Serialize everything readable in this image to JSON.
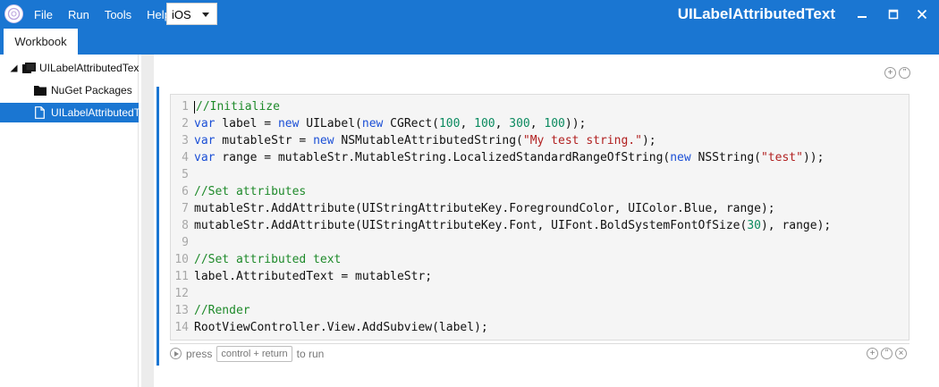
{
  "titlebar": {
    "menu": [
      "File",
      "Run",
      "Tools",
      "Help"
    ],
    "platform_selected": "iOS",
    "window_title": "UILabelAttributedText"
  },
  "tabs": [
    {
      "label": "Workbook"
    }
  ],
  "sidebar": {
    "items": [
      {
        "label": "UILabelAttributedText",
        "type": "workbook",
        "expanded": true
      },
      {
        "label": "NuGet Packages",
        "type": "folder"
      },
      {
        "label": "UILabelAttributedText",
        "type": "file",
        "selected": true
      }
    ]
  },
  "editor": {
    "lines": [
      {
        "n": "1",
        "tokens": [
          {
            "t": "//Initialize",
            "c": "cm"
          }
        ]
      },
      {
        "n": "2",
        "tokens": [
          {
            "t": "var",
            "c": "kw"
          },
          {
            "t": " label = ",
            "c": "code"
          },
          {
            "t": "new",
            "c": "kw"
          },
          {
            "t": " UILabel(",
            "c": "code"
          },
          {
            "t": "new",
            "c": "kw"
          },
          {
            "t": " CGRect(",
            "c": "code"
          },
          {
            "t": "100",
            "c": "num"
          },
          {
            "t": ", ",
            "c": "code"
          },
          {
            "t": "100",
            "c": "num"
          },
          {
            "t": ", ",
            "c": "code"
          },
          {
            "t": "300",
            "c": "num"
          },
          {
            "t": ", ",
            "c": "code"
          },
          {
            "t": "100",
            "c": "num"
          },
          {
            "t": "));",
            "c": "code"
          }
        ]
      },
      {
        "n": "3",
        "tokens": [
          {
            "t": "var",
            "c": "kw"
          },
          {
            "t": " mutableStr = ",
            "c": "code"
          },
          {
            "t": "new",
            "c": "kw"
          },
          {
            "t": " NSMutableAttributedString(",
            "c": "code"
          },
          {
            "t": "\"My test string.\"",
            "c": "str"
          },
          {
            "t": ");",
            "c": "code"
          }
        ]
      },
      {
        "n": "4",
        "tokens": [
          {
            "t": "var",
            "c": "kw"
          },
          {
            "t": " range = mutableStr.MutableString.LocalizedStandardRangeOfString(",
            "c": "code"
          },
          {
            "t": "new",
            "c": "kw"
          },
          {
            "t": " NSString(",
            "c": "code"
          },
          {
            "t": "\"test\"",
            "c": "str"
          },
          {
            "t": "));",
            "c": "code"
          }
        ]
      },
      {
        "n": "5",
        "tokens": []
      },
      {
        "n": "6",
        "tokens": [
          {
            "t": "//Set attributes",
            "c": "cm"
          }
        ]
      },
      {
        "n": "7",
        "tokens": [
          {
            "t": "mutableStr.AddAttribute(UIStringAttributeKey.ForegroundColor, UIColor.Blue, range);",
            "c": "code"
          }
        ]
      },
      {
        "n": "8",
        "tokens": [
          {
            "t": "mutableStr.AddAttribute(UIStringAttributeKey.Font, UIFont.BoldSystemFontOfSize(",
            "c": "code"
          },
          {
            "t": "30",
            "c": "num"
          },
          {
            "t": "), range);",
            "c": "code"
          }
        ]
      },
      {
        "n": "9",
        "tokens": []
      },
      {
        "n": "10",
        "tokens": [
          {
            "t": "//Set attributed text",
            "c": "cm"
          }
        ]
      },
      {
        "n": "11",
        "tokens": [
          {
            "t": "label.AttributedText = mutableStr;",
            "c": "code"
          }
        ]
      },
      {
        "n": "12",
        "tokens": []
      },
      {
        "n": "13",
        "tokens": [
          {
            "t": "//Render",
            "c": "cm"
          }
        ]
      },
      {
        "n": "14",
        "tokens": [
          {
            "t": "RootViewController.View.AddSubview(label);",
            "c": "code"
          }
        ]
      }
    ]
  },
  "footer": {
    "press_label": "press",
    "key_label": "control + return",
    "run_label": "to run"
  },
  "colors": {
    "accent": "#1a76d2",
    "keyword": "#1b4fd6",
    "number": "#0b8a5f",
    "string": "#b11f1f",
    "comment": "#1e8a2a"
  }
}
